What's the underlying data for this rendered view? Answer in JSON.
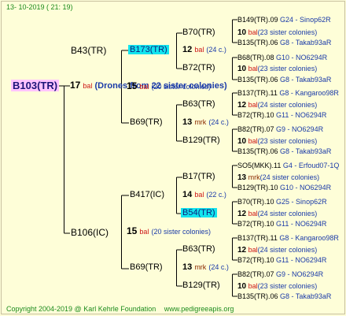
{
  "header": {
    "date": "13- 10-2019 ( 21: 19)"
  },
  "colors": {
    "background": "#fefed8",
    "lines": "#000000",
    "bal": "#cc1414",
    "mrk": "#8a2a00",
    "colony_id": "#1a3aa8",
    "footer": "#1c8b1c",
    "root_highlight": "#ffc4ff",
    "cyan_highlight": "#12e4ee"
  },
  "root": {
    "name": "B103(TR)",
    "num": "17",
    "tag": "bal",
    "note": "(Drones from 22 sister colonies)"
  },
  "gen1": [
    {
      "name": "B43(TR)",
      "num": "15",
      "tag": "bal",
      "note": "(20 sister colonies)"
    },
    {
      "name": "B106(IC)",
      "num": "15",
      "tag": "bal",
      "note": "(20 sister colonies)"
    }
  ],
  "gen2": [
    {
      "name": "B173(TR)",
      "num": "12",
      "tag": "bal",
      "note": "(24 c.)"
    },
    {
      "name": "B69(TR)",
      "num": "13",
      "tag": "mrk",
      "note": "(24 c.)"
    },
    {
      "name": "B417(IC)",
      "num": "14",
      "tag": "bal",
      "note": "(22 c.)"
    },
    {
      "name": "B69(TR)",
      "num": "13",
      "tag": "mrk",
      "note": "(24 c.)"
    }
  ],
  "gen3": [
    {
      "name": "B70(TR)",
      "num": "10",
      "tag": "bal",
      "note": "(23 sister colonies)"
    },
    {
      "name": "B72(TR)",
      "num": "10",
      "tag": "bal",
      "note": "(23 sister colonies)"
    },
    {
      "name": "B63(TR)",
      "num": "12",
      "tag": "bal",
      "note": "(24 sister colonies)"
    },
    {
      "name": "B129(TR)",
      "num": "10",
      "tag": "bal",
      "note": "(23 sister colonies)"
    },
    {
      "name": "B17(TR)",
      "num": "13",
      "tag": "mrk",
      "note": "(24 sister colonies)"
    },
    {
      "name": "B54(TR)",
      "num": "12",
      "tag": "bal",
      "note": "(24 sister colonies)"
    },
    {
      "name": "B63(TR)",
      "num": "12",
      "tag": "bal",
      "note": "(24 sister colonies)"
    },
    {
      "name": "B129(TR)",
      "num": "10",
      "tag": "bal",
      "note": "(23 sister colonies)"
    }
  ],
  "gen4": [
    {
      "name": "B149(TR).09",
      "colony": "G24 - Sinop62R"
    },
    {
      "name": "B135(TR).06",
      "colony": "G8 - Takab93aR"
    },
    {
      "name": "B68(TR).08",
      "colony": "G10 - NO6294R"
    },
    {
      "name": "B135(TR).06",
      "colony": "G8 - Takab93aR"
    },
    {
      "name": "B137(TR).11",
      "colony": "G8 - Kangaroo98R"
    },
    {
      "name": "B72(TR).10",
      "colony": "G11 - NO6294R"
    },
    {
      "name": "B82(TR).07",
      "colony": "G9 - NO6294R"
    },
    {
      "name": "B135(TR).06",
      "colony": "G8 - Takab93aR"
    },
    {
      "name": "SO5(MKK).11",
      "colony": "G4 - Erfoud07-1Q"
    },
    {
      "name": "B129(TR).10",
      "colony": "G10 - NO6294R"
    },
    {
      "name": "B70(TR).10",
      "colony": "G25 - Sinop62R"
    },
    {
      "name": "B72(TR).10",
      "colony": "G11 - NO6294R"
    },
    {
      "name": "B137(TR).11",
      "colony": "G8 - Kangaroo98R"
    },
    {
      "name": "B72(TR).10",
      "colony": "G11 - NO6294R"
    },
    {
      "name": "B82(TR).07",
      "colony": "G9 - NO6294R"
    },
    {
      "name": "B135(TR).06",
      "colony": "G8 - Takab93aR"
    }
  ],
  "footer": {
    "copyright": "Copyright 2004-2019 @ Karl Kehrle Foundation",
    "url": "www.pedigreeapis.org"
  }
}
